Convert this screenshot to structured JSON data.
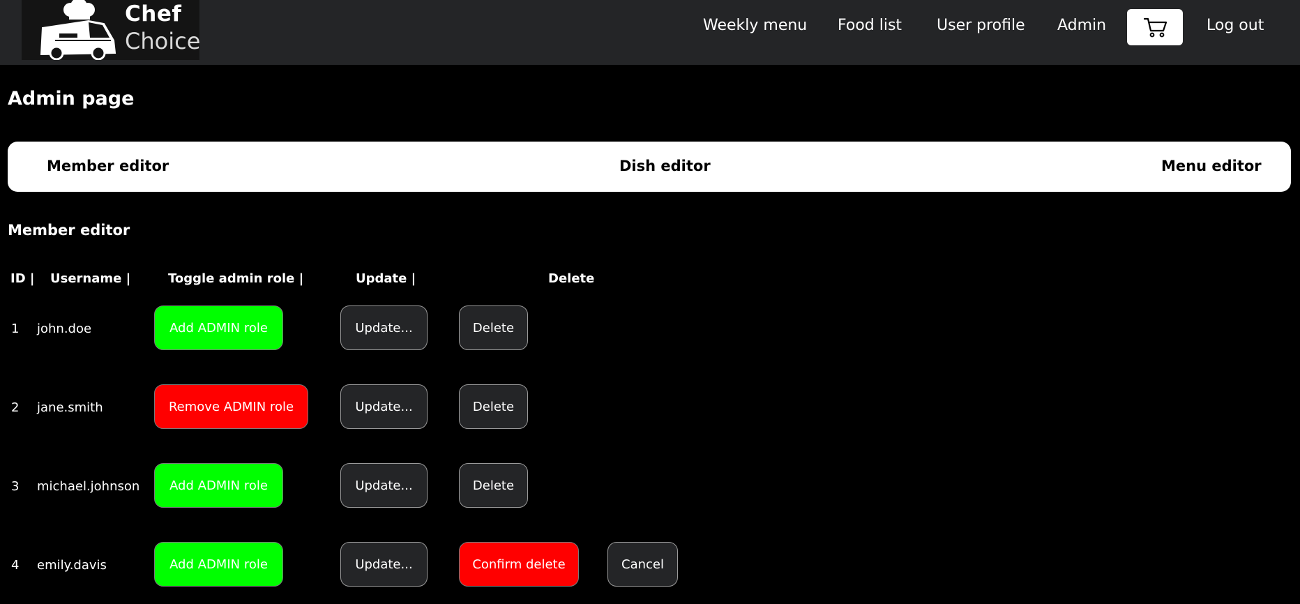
{
  "header": {
    "logo": {
      "line1": "Chef",
      "line2": "Choice"
    },
    "nav": [
      {
        "label": "Weekly menu"
      },
      {
        "label": "Food list"
      },
      {
        "label": "User profile"
      },
      {
        "label": "Admin"
      }
    ],
    "cart_icon": "shopping-cart-icon",
    "logout_label": "Log out"
  },
  "page": {
    "title": "Admin page",
    "editor_tabs": [
      "Member editor",
      "Dish editor",
      "Menu editor"
    ],
    "section_title": "Member editor"
  },
  "table": {
    "headers": [
      "ID |",
      "Username |",
      "Toggle admin role |",
      "Update |",
      "Delete"
    ],
    "rows": [
      {
        "id": "1",
        "username": "john.doe",
        "role_button": "Add ADMIN role",
        "update_button": "Update...",
        "delete_button": "Delete"
      },
      {
        "id": "2",
        "username": "jane.smith",
        "role_button": "Remove ADMIN role",
        "update_button": "Update...",
        "delete_button": "Delete"
      },
      {
        "id": "3",
        "username": "michael.johnson",
        "role_button": "Add ADMIN role",
        "update_button": "Update...",
        "delete_button": "Delete"
      },
      {
        "id": "4",
        "username": "emily.davis",
        "role_button": "Add ADMIN role",
        "update_button": "Update...",
        "confirm_delete_button": "Confirm delete",
        "cancel_button": "Cancel"
      }
    ]
  },
  "colors": {
    "navbar": "#242527",
    "add_role": "#00ff00",
    "remove_role": "#ff0000",
    "confirm_delete": "#ff0000",
    "dark_button": "#242527"
  }
}
